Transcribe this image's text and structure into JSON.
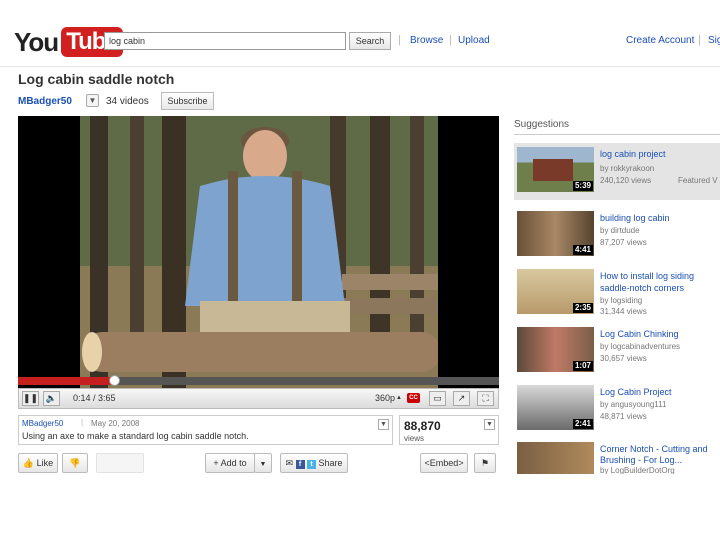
{
  "header": {
    "logo_you": "You",
    "logo_tube": "Tube",
    "search_value": "log cabin",
    "search_button": "Search",
    "nav_browse": "Browse",
    "nav_upload": "Upload",
    "create_account": "Create Account",
    "sign_in": "Sig"
  },
  "video": {
    "title": "Log cabin saddle notch",
    "channel": "MBadger50",
    "video_count": "34 videos",
    "subscribe": "Subscribe",
    "time": "0:14 / 3:65",
    "quality": "360p",
    "cc_label": "CC",
    "progress_fraction": 0.2,
    "author": "MBadger50",
    "date": "May 20, 2008",
    "description": "Using an axe to make a standard log cabin saddle notch.",
    "views_count": "88,870",
    "views_label": "views"
  },
  "actions": {
    "like": "Like",
    "add_to": "Add to",
    "share": "Share",
    "embed": "<Embed>"
  },
  "suggestions": {
    "heading": "Suggestions",
    "items": [
      {
        "title": "log cabin project",
        "by": "by rokkyrakoon",
        "views": "240,120 views",
        "featured": "Featured V",
        "duration": "5:39"
      },
      {
        "title": "building log cabin",
        "by": "by dirtdude",
        "views": "87,207 views",
        "duration": "4:41"
      },
      {
        "title": "How to install log siding",
        "title2": "saddle-notch corners",
        "by": "by logsiding",
        "views": "31,344 views",
        "duration": "2:35"
      },
      {
        "title": "Log Cabin Chinking",
        "by": "by logcabinadventures",
        "views": "30,657 views",
        "duration": "1:07"
      },
      {
        "title": "Log Cabin Project",
        "by": "by angusyoung111",
        "views": "48,871 views",
        "duration": "2:41"
      },
      {
        "title": "Corner Notch - Cutting and",
        "title2": "Brushing - For Log...",
        "by": "by LogBuilderDotOrg",
        "duration": ""
      }
    ]
  },
  "colors": {
    "link": "#1a4fb5",
    "brand_red": "#d21f1f",
    "progress_red": "#c61f1f"
  }
}
